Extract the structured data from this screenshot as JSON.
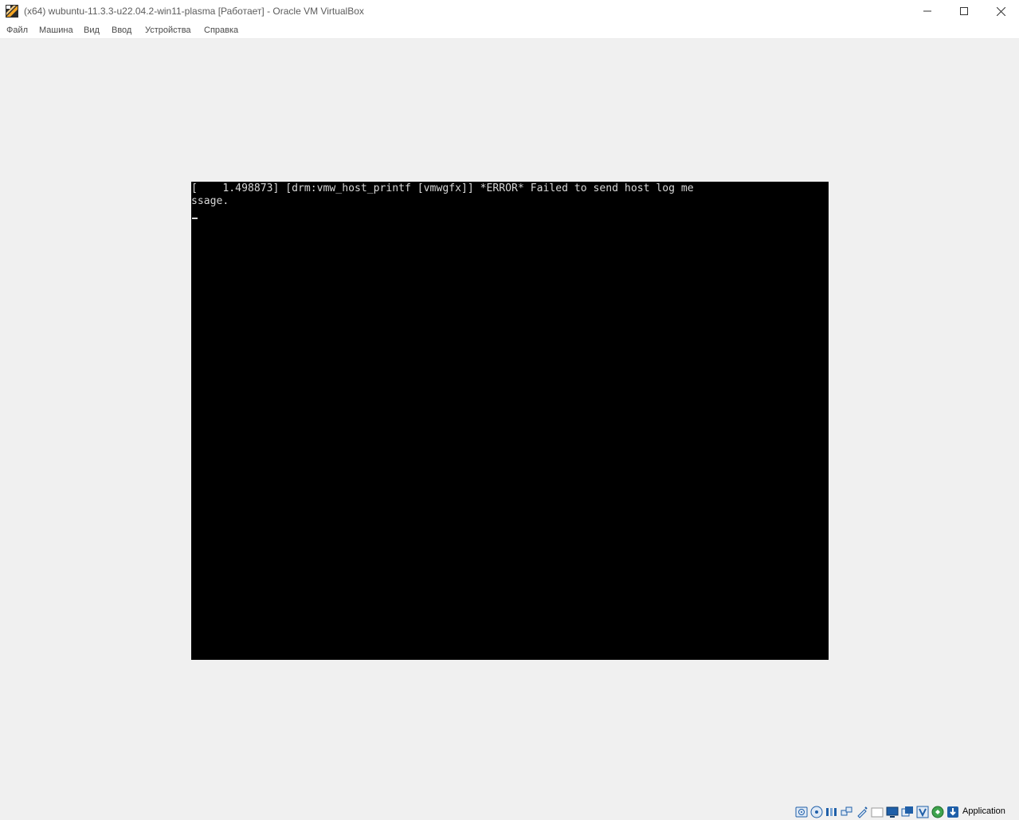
{
  "window": {
    "title": "(x64) wubuntu-11.3.3-u22.04.2-win11-plasma [Работает] - Oracle VM VirtualBox",
    "controls": {
      "minimize": "minimize-icon",
      "maximize": "maximize-icon",
      "close": "close-icon"
    }
  },
  "menubar": {
    "items": [
      {
        "label": "Файл"
      },
      {
        "label": "Машина"
      },
      {
        "label": "Вид"
      },
      {
        "label": "Ввод"
      },
      {
        "label": "Устройства"
      },
      {
        "label": "Справка"
      }
    ]
  },
  "vm": {
    "console_lines": [
      "[    1.498873] [drm:vmw_host_printf [vmwgfx]] *ERROR* Failed to send host log me",
      "ssage."
    ]
  },
  "statusbar": {
    "icons": [
      "hard-disk-icon",
      "optical-drive-icon",
      "audio-icon",
      "network-icon",
      "usb-icon",
      "shared-folders-icon",
      "display-icon",
      "recording-icon",
      "virtualization-icon",
      "mouse-integration-icon",
      "keyboard-icon"
    ],
    "host_key_label": "Application"
  },
  "colors": {
    "background": "#f0f0f0",
    "titlebar": "#ffffff",
    "vm_screen": "#000000",
    "console_text": "#d8d8d8",
    "icon_blue": "#1f5fa8"
  }
}
